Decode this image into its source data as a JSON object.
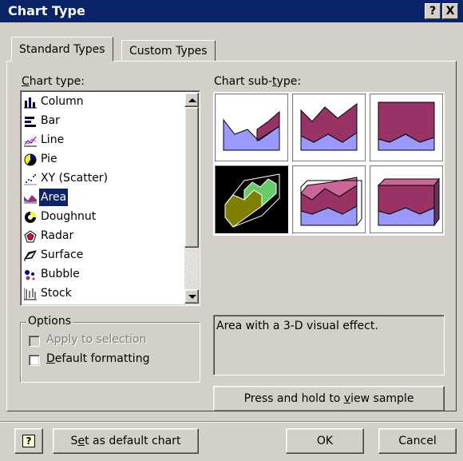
{
  "window": {
    "title": "Chart Type",
    "help_button": "?",
    "close_button": "X"
  },
  "tabs": [
    {
      "label": "Standard Types"
    },
    {
      "label": "Custom Types"
    }
  ],
  "chart_type": {
    "label": "Chart type:",
    "items": [
      {
        "label": "Column",
        "icon": "column-chart-icon"
      },
      {
        "label": "Bar",
        "icon": "bar-chart-icon"
      },
      {
        "label": "Line",
        "icon": "line-chart-icon"
      },
      {
        "label": "Pie",
        "icon": "pie-chart-icon"
      },
      {
        "label": "XY (Scatter)",
        "icon": "scatter-chart-icon"
      },
      {
        "label": "Area",
        "icon": "area-chart-icon"
      },
      {
        "label": "Doughnut",
        "icon": "doughnut-chart-icon"
      },
      {
        "label": "Radar",
        "icon": "radar-chart-icon"
      },
      {
        "label": "Surface",
        "icon": "surface-chart-icon"
      },
      {
        "label": "Bubble",
        "icon": "bubble-chart-icon"
      },
      {
        "label": "Stock",
        "icon": "stock-chart-icon"
      }
    ],
    "selected": "Area"
  },
  "subtype": {
    "label": "Chart sub-type:",
    "selected_index": 3,
    "description": "Area with a 3-D visual effect."
  },
  "options": {
    "label": "Options",
    "apply_to_selection": {
      "label": "Apply to selection",
      "checked": false,
      "enabled": false
    },
    "default_formatting": {
      "label": "Default formatting",
      "checked": false,
      "enabled": true
    }
  },
  "buttons": {
    "sample": "Press and hold to view sample",
    "help": "?",
    "set_default": "Set as default chart",
    "ok": "OK",
    "cancel": "Cancel"
  },
  "colors": {
    "titlebar": "#0a246a",
    "selection": "#0a246a",
    "area_front": "#993366",
    "area_back": "#9999ff",
    "area3d_green": "#66cc66",
    "area3d_olive": "#808000"
  }
}
